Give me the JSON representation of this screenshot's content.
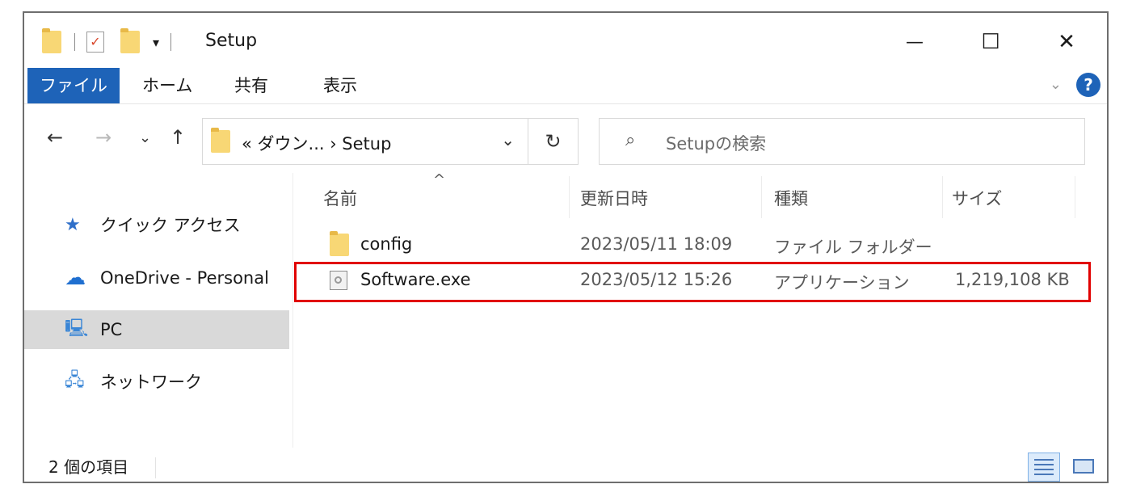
{
  "window": {
    "title": "Setup"
  },
  "quick_access_toolbar": {
    "separator": "|",
    "dropdown_glyph": "▾"
  },
  "window_controls": {
    "minimize": "—",
    "maximize": "☐",
    "close": "✕"
  },
  "ribbon": {
    "tabs": [
      "ファイル",
      "ホーム",
      "共有",
      "表示"
    ],
    "collapse_glyph": "⌄",
    "help_glyph": "?"
  },
  "nav": {
    "back": "←",
    "forward": "→",
    "recent": "⌄",
    "up": "↑",
    "address_text": "« ダウン... › Setup",
    "address_dropdown": "⌄",
    "refresh": "↻",
    "search_icon": "⌕",
    "search_placeholder": "Setupの検索"
  },
  "nav_pane": {
    "items": [
      {
        "label": "クイック アクセス",
        "icon": "star-icon",
        "glyph": "★",
        "color": "#2f6fc9"
      },
      {
        "label": "OneDrive - Personal",
        "icon": "cloud-icon",
        "glyph": "☁",
        "color": "#1f6fd0"
      },
      {
        "label": "PC",
        "icon": "computer-icon",
        "glyph": "🖳",
        "color": "#3a86d6",
        "selected": true
      },
      {
        "label": "ネットワーク",
        "icon": "network-icon",
        "glyph": "🖧",
        "color": "#3a86d6"
      }
    ]
  },
  "file_list": {
    "sort_indicator": "^",
    "columns": [
      "名前",
      "更新日時",
      "種類",
      "サイズ"
    ],
    "rows": [
      {
        "name": "config",
        "modified": "2023/05/11 18:09",
        "type": "ファイル フォルダー",
        "size": "",
        "icon": "folder-icon"
      },
      {
        "name": "Software.exe",
        "modified": "2023/05/12 15:26",
        "type": "アプリケーション",
        "size": "1,219,108 KB",
        "icon": "exe-icon",
        "highlighted": true
      }
    ],
    "highlight_color": "#e10000"
  },
  "status_bar": {
    "item_count": "2 個の項目"
  },
  "colors": {
    "accent": "#1e63b8",
    "folder": "#f8d775",
    "selected_bg": "#d9d9d9"
  }
}
